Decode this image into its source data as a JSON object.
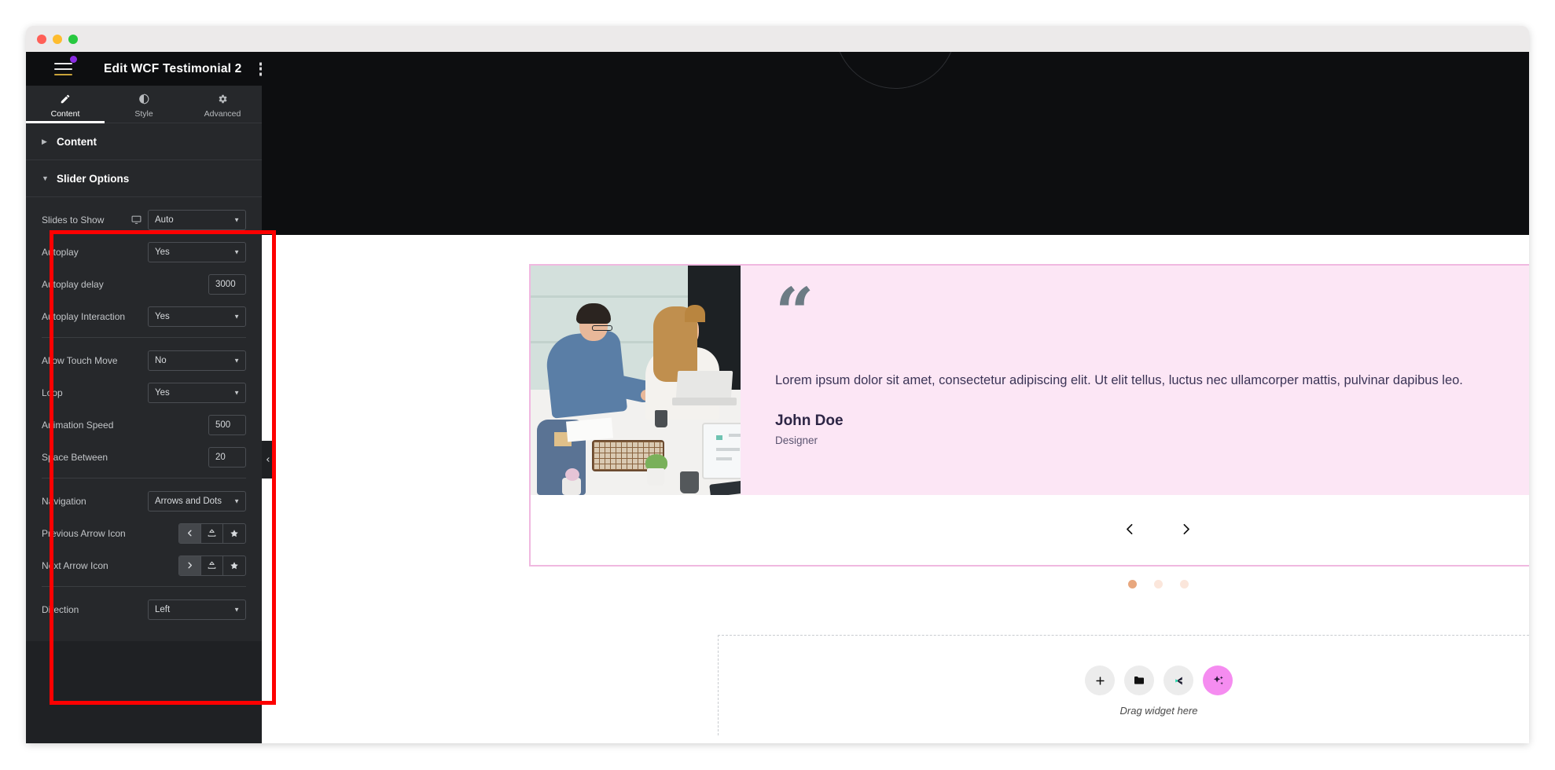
{
  "window": {
    "traffic_lights": [
      "close",
      "minimize",
      "maximize"
    ]
  },
  "panel": {
    "title": "Edit WCF Testimonial 2",
    "menu_icon": "hamburger-menu-icon",
    "apps_icon": "apps-grid-icon",
    "tabs": [
      {
        "label": "Content",
        "icon": "pencil-icon",
        "active": true
      },
      {
        "label": "Style",
        "icon": "half-circle-icon",
        "active": false
      },
      {
        "label": "Advanced",
        "icon": "gear-icon",
        "active": false
      }
    ],
    "sections": [
      {
        "label": "Content",
        "expanded": false
      },
      {
        "label": "Slider Options",
        "expanded": true
      }
    ],
    "controls": [
      {
        "label": "Slides to Show",
        "type": "select",
        "value": "Auto",
        "responsive_icon": "desktop-icon"
      },
      {
        "label": "Autoplay",
        "type": "select",
        "value": "Yes"
      },
      {
        "label": "Autoplay delay",
        "type": "number",
        "value": "3000"
      },
      {
        "label": "Autoplay Interaction",
        "type": "select",
        "value": "Yes"
      },
      {
        "label": "Allow Touch Move",
        "type": "select",
        "value": "No"
      },
      {
        "label": "Loop",
        "type": "select",
        "value": "Yes"
      },
      {
        "label": "Animation Speed",
        "type": "number",
        "value": "500"
      },
      {
        "label": "Space Between",
        "type": "number",
        "value": "20"
      },
      {
        "label": "Navigation",
        "type": "select",
        "value": "Arrows and Dots"
      },
      {
        "label": "Previous Arrow Icon",
        "type": "icon-group",
        "icons": [
          "chevron-left-icon",
          "upload-icon",
          "star-icon"
        ],
        "selected": 0
      },
      {
        "label": "Next Arrow Icon",
        "type": "icon-group",
        "icons": [
          "chevron-right-icon",
          "upload-icon",
          "star-icon"
        ],
        "selected": 0
      },
      {
        "label": "Direction",
        "type": "select",
        "value": "Left"
      }
    ],
    "highlight_color": "#fe0000"
  },
  "canvas": {
    "collapse_handle_icon": "chevron-left-icon",
    "testimonial": {
      "quote_mark": "“",
      "text": "Lorem ipsum dolor sit amet, consectetur adipiscing elit. Ut elit tellus, luctus nec ullamcorper mattis, pulvinar dapibus leo.",
      "name": "John Doe",
      "role": "Designer",
      "photo_alt": "two-coworkers-at-desk-photo",
      "background_color": "#fce6f5"
    },
    "navigation": {
      "prev_icon": "chevron-left-icon",
      "next_icon": "chevron-right-icon",
      "dots": [
        {
          "active": true
        },
        {
          "active": false
        },
        {
          "active": false
        }
      ],
      "active_dot_color": "#e8a77e",
      "inactive_dot_color": "#fbe6db"
    },
    "drop_zone": {
      "label": "Drag widget here",
      "buttons": [
        {
          "icon": "plus-icon",
          "name": "add-widget-button"
        },
        {
          "icon": "folder-icon",
          "name": "templates-button"
        },
        {
          "icon": "brand-logo-icon",
          "name": "brand-library-button"
        },
        {
          "icon": "sparkle-icon",
          "name": "ai-button"
        }
      ]
    }
  }
}
